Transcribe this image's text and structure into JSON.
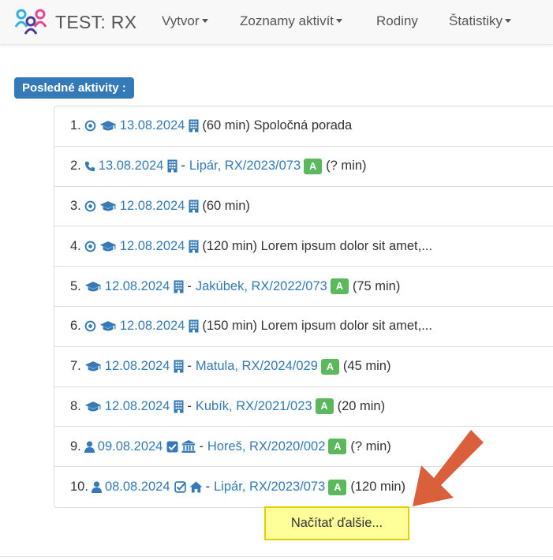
{
  "brand": {
    "title": "TEST: RX"
  },
  "nav": {
    "create": "Vytvor",
    "lists": "Zoznamy aktivít",
    "families": "Rodiny",
    "stats": "Štatistiky"
  },
  "section_label": "Posledné aktivity :",
  "activities": [
    {
      "num": "1.",
      "icons": [
        "target-icon",
        "graduation-cap-icon"
      ],
      "date": "13.08.2024",
      "place_icon": "building-icon",
      "sep": "",
      "client": "",
      "badge": "",
      "detail": "(60 min) Spoločná porada"
    },
    {
      "num": "2.",
      "icons": [
        "phone-icon"
      ],
      "date": "13.08.2024",
      "place_icon": "building-icon",
      "sep": "-",
      "client": "Lipár, RX/2023/073",
      "badge": "A",
      "detail": "(? min)"
    },
    {
      "num": "3.",
      "icons": [
        "target-icon",
        "graduation-cap-icon"
      ],
      "date": "12.08.2024",
      "place_icon": "building-icon",
      "sep": "",
      "client": "",
      "badge": "",
      "detail": "(60 min)"
    },
    {
      "num": "4.",
      "icons": [
        "target-icon",
        "graduation-cap-icon"
      ],
      "date": "12.08.2024",
      "place_icon": "building-icon",
      "sep": "",
      "client": "",
      "badge": "",
      "detail": "(120 min) Lorem ipsum dolor sit amet,..."
    },
    {
      "num": "5.",
      "icons": [
        "graduation-cap-icon"
      ],
      "date": "12.08.2024",
      "place_icon": "building-icon",
      "sep": "-",
      "client": "Jakúbek, RX/2022/073",
      "badge": "A",
      "detail": "(75 min)"
    },
    {
      "num": "6.",
      "icons": [
        "target-icon",
        "graduation-cap-icon"
      ],
      "date": "12.08.2024",
      "place_icon": "building-icon",
      "sep": "",
      "client": "",
      "badge": "",
      "detail": "(150 min) Lorem ipsum dolor sit amet,..."
    },
    {
      "num": "7.",
      "icons": [
        "graduation-cap-icon"
      ],
      "date": "12.08.2024",
      "place_icon": "building-icon",
      "sep": "-",
      "client": "Matula, RX/2024/029",
      "badge": "A",
      "detail": "(45 min)"
    },
    {
      "num": "8.",
      "icons": [
        "graduation-cap-icon"
      ],
      "date": "12.08.2024",
      "place_icon": "building-icon",
      "sep": "-",
      "client": "Kubík, RX/2021/023",
      "badge": "A",
      "detail": "(20 min)"
    },
    {
      "num": "9.",
      "icons": [
        "user-icon"
      ],
      "date": "09.08.2024",
      "place_icon": "checkbox-checked-icon",
      "place_icon2": "institution-icon",
      "sep": "-",
      "client": "Horeš, RX/2020/002",
      "badge": "A",
      "detail": "(? min)"
    },
    {
      "num": "10.",
      "icons": [
        "user-icon"
      ],
      "date": "08.08.2024",
      "place_icon": "checkbox-outline-icon",
      "place_icon2": "home-icon",
      "sep": "-",
      "client": "Lipár, RX/2023/073",
      "badge": "A",
      "detail": "(120 min)"
    }
  ],
  "load_more": "Načítať ďalšie...",
  "colors": {
    "link": "#337ab7",
    "badge": "#5cb85c",
    "label_bg": "#337ab7",
    "highlight": "#ffff99",
    "arrow": "#d9603b"
  }
}
